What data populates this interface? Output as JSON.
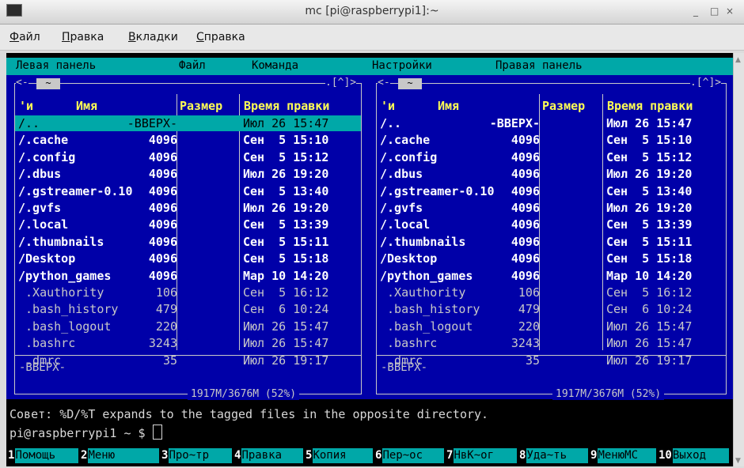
{
  "window": {
    "title": "mc [pi@raspberrypi1]:~",
    "minimize": "_",
    "maximize": "□",
    "close": "×"
  },
  "menubar": [
    "Файл",
    "Правка",
    "Вкладки",
    "Справка"
  ],
  "mc_menu": [
    "Левая панель",
    "Файл",
    "Команда",
    "Настройки",
    "Правая панель"
  ],
  "left_panel": {
    "path": "~",
    "top_right": ".[^]>",
    "headers": {
      "name_flag": "'и",
      "name": "Имя",
      "size": "Размер",
      "mtime": "Время правки"
    },
    "rows": [
      {
        "name": "/..",
        "size": "-ВВЕРХ-",
        "mtime": "Июл 26 15:47",
        "kind": "dir",
        "selected": true
      },
      {
        "name": "/.cache",
        "size": "4096",
        "mtime": "Сен  5 15:10",
        "kind": "dir"
      },
      {
        "name": "/.config",
        "size": "4096",
        "mtime": "Сен  5 15:12",
        "kind": "dir"
      },
      {
        "name": "/.dbus",
        "size": "4096",
        "mtime": "Июл 26 19:20",
        "kind": "dir"
      },
      {
        "name": "/.gstreamer-0.10",
        "size": "4096",
        "mtime": "Сен  5 13:40",
        "kind": "dir"
      },
      {
        "name": "/.gvfs",
        "size": "4096",
        "mtime": "Июл 26 19:20",
        "kind": "dir"
      },
      {
        "name": "/.local",
        "size": "4096",
        "mtime": "Сен  5 13:39",
        "kind": "dir"
      },
      {
        "name": "/.thumbnails",
        "size": "4096",
        "mtime": "Сен  5 15:11",
        "kind": "dir"
      },
      {
        "name": "/Desktop",
        "size": "4096",
        "mtime": "Сен  5 15:18",
        "kind": "dir"
      },
      {
        "name": "/python_games",
        "size": "4096",
        "mtime": "Мар 10 14:20",
        "kind": "dir"
      },
      {
        "name": " .Xauthority",
        "size": "106",
        "mtime": "Сен  5 16:12",
        "kind": "file"
      },
      {
        "name": " .bash_history",
        "size": "479",
        "mtime": "Сен  6 10:24",
        "kind": "file"
      },
      {
        "name": " .bash_logout",
        "size": "220",
        "mtime": "Июл 26 15:47",
        "kind": "file"
      },
      {
        "name": " .bashrc",
        "size": "3243",
        "mtime": "Июл 26 15:47",
        "kind": "file"
      },
      {
        "name": " .dmrc",
        "size": "35",
        "mtime": "Июл 26 19:17",
        "kind": "file"
      }
    ],
    "mini_status": "-ВВЕРХ-",
    "footer": "1917M/3676M (52%)"
  },
  "right_panel": {
    "path": "~",
    "top_right": ".[^]>",
    "headers": {
      "name_flag": "'и",
      "name": "Имя",
      "size": "Размер",
      "mtime": "Время правки"
    },
    "rows": [
      {
        "name": "/..",
        "size": "-ВВЕРХ-",
        "mtime": "Июл 26 15:47",
        "kind": "dir"
      },
      {
        "name": "/.cache",
        "size": "4096",
        "mtime": "Сен  5 15:10",
        "kind": "dir"
      },
      {
        "name": "/.config",
        "size": "4096",
        "mtime": "Сен  5 15:12",
        "kind": "dir"
      },
      {
        "name": "/.dbus",
        "size": "4096",
        "mtime": "Июл 26 19:20",
        "kind": "dir"
      },
      {
        "name": "/.gstreamer-0.10",
        "size": "4096",
        "mtime": "Сен  5 13:40",
        "kind": "dir"
      },
      {
        "name": "/.gvfs",
        "size": "4096",
        "mtime": "Июл 26 19:20",
        "kind": "dir"
      },
      {
        "name": "/.local",
        "size": "4096",
        "mtime": "Сен  5 13:39",
        "kind": "dir"
      },
      {
        "name": "/.thumbnails",
        "size": "4096",
        "mtime": "Сен  5 15:11",
        "kind": "dir"
      },
      {
        "name": "/Desktop",
        "size": "4096",
        "mtime": "Сен  5 15:18",
        "kind": "dir"
      },
      {
        "name": "/python_games",
        "size": "4096",
        "mtime": "Мар 10 14:20",
        "kind": "dir"
      },
      {
        "name": " .Xauthority",
        "size": "106",
        "mtime": "Сен  5 16:12",
        "kind": "file"
      },
      {
        "name": " .bash_history",
        "size": "479",
        "mtime": "Сен  6 10:24",
        "kind": "file"
      },
      {
        "name": " .bash_logout",
        "size": "220",
        "mtime": "Июл 26 15:47",
        "kind": "file"
      },
      {
        "name": " .bashrc",
        "size": "3243",
        "mtime": "Июл 26 15:47",
        "kind": "file"
      },
      {
        "name": " .dmrc",
        "size": "35",
        "mtime": "Июл 26 19:17",
        "kind": "file"
      }
    ],
    "mini_status": "-ВВЕРХ-",
    "footer": "1917M/3676M (52%)"
  },
  "hint": "Совет: %D/%T expands to the tagged files in the opposite directory.",
  "prompt": "pi@raspberrypi1 ~ $ ",
  "fkeys": [
    {
      "num": "1",
      "label": "Помощь"
    },
    {
      "num": "2",
      "label": "Меню"
    },
    {
      "num": "3",
      "label": "Про~тр"
    },
    {
      "num": "4",
      "label": "Правка"
    },
    {
      "num": "5",
      "label": "Копия"
    },
    {
      "num": "6",
      "label": "Пер~ос"
    },
    {
      "num": "7",
      "label": "НвК~ог"
    },
    {
      "num": "8",
      "label": "Уда~ть"
    },
    {
      "num": "9",
      "label": "МенюМС"
    },
    {
      "num": "10",
      "label": "Выход"
    }
  ],
  "colors": {
    "panel_bg": "#0000a8",
    "accent_cyan": "#00a8a8",
    "header_yellow": "#ffff55",
    "terminal_bg": "#000000"
  }
}
